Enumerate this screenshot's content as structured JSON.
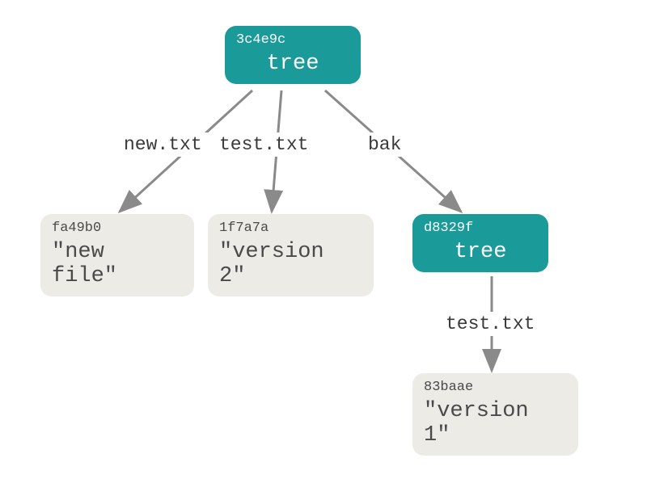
{
  "nodes": {
    "root": {
      "hash": "3c4e9c",
      "label": "tree"
    },
    "blob1": {
      "hash": "fa49b0",
      "label": "\"new file\""
    },
    "blob2": {
      "hash": "1f7a7a",
      "label": "\"version 2\""
    },
    "subtree": {
      "hash": "d8329f",
      "label": "tree"
    },
    "blob3": {
      "hash": "83baae",
      "label": "\"version 1\""
    }
  },
  "edges": {
    "e1": "new.txt",
    "e2": "test.txt",
    "e3": "bak",
    "e4": "test.txt"
  }
}
